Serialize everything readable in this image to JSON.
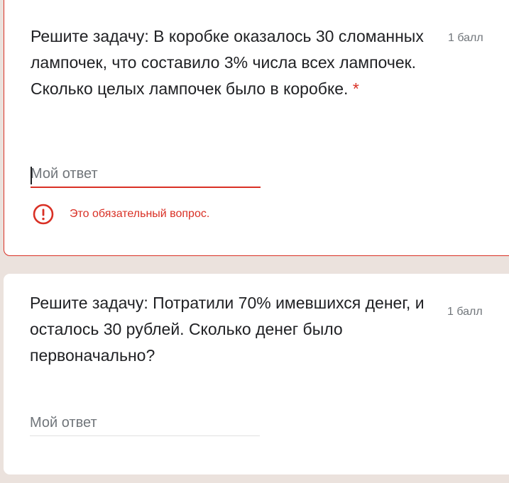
{
  "questions": [
    {
      "text": "Решите задачу: В коробке оказалось 30 сломанных лампочек, что составило 3% числа всех лампочек. Сколько целых лампочек было в коробке.",
      "required_marker": "*",
      "points": "1 балл",
      "answer_placeholder": "Мой ответ",
      "answer_value": "",
      "error_message": "Это обязательный вопрос.",
      "error_icon": "error-circle-icon"
    },
    {
      "text": "Решите задачу: Потратили 70% имевшихся денег, и осталось 30 рублей. Сколько денег было первоначально?",
      "points": "1 балл",
      "answer_placeholder": "Мой ответ",
      "answer_value": ""
    }
  ],
  "colors": {
    "error": "#d93025",
    "page_background": "#ebe2dd",
    "card_background": "#ffffff",
    "text_primary": "#202124",
    "text_secondary": "#70757a"
  }
}
